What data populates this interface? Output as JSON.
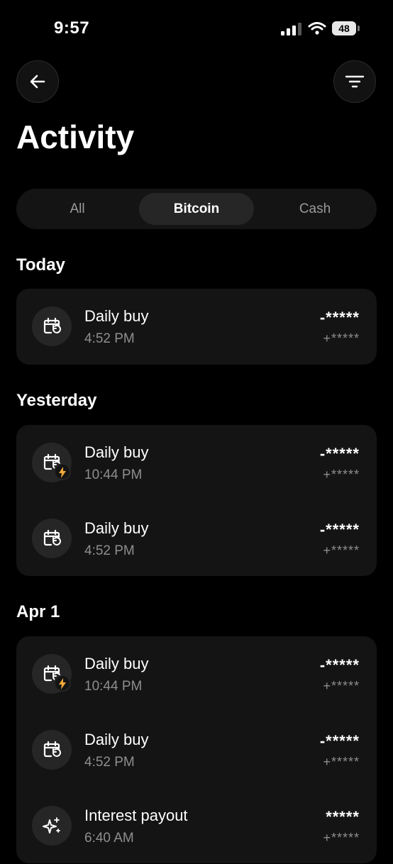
{
  "status_bar": {
    "time": "9:57",
    "battery": "48"
  },
  "page": {
    "title": "Activity"
  },
  "tabs": [
    {
      "label": "All"
    },
    {
      "label": "Bitcoin"
    },
    {
      "label": "Cash"
    }
  ],
  "active_tab": "Bitcoin",
  "sections": [
    {
      "title": "Today",
      "items": [
        {
          "title": "Daily buy",
          "time": "4:52 PM",
          "amount": "-*****",
          "sub_amount": "+*****",
          "icon": "calendar-repeat-icon",
          "lightning": false
        }
      ]
    },
    {
      "title": "Yesterday",
      "items": [
        {
          "title": "Daily buy",
          "time": "10:44 PM",
          "amount": "-*****",
          "sub_amount": "+*****",
          "icon": "calendar-repeat-icon",
          "lightning": true
        },
        {
          "title": "Daily buy",
          "time": "4:52 PM",
          "amount": "-*****",
          "sub_amount": "+*****",
          "icon": "calendar-repeat-icon",
          "lightning": false
        }
      ]
    },
    {
      "title": "Apr 1",
      "items": [
        {
          "title": "Daily buy",
          "time": "10:44 PM",
          "amount": "-*****",
          "sub_amount": "+*****",
          "icon": "calendar-repeat-icon",
          "lightning": true
        },
        {
          "title": "Daily buy",
          "time": "4:52 PM",
          "amount": "-*****",
          "sub_amount": "+*****",
          "icon": "calendar-repeat-icon",
          "lightning": false
        },
        {
          "title": "Interest payout",
          "time": "6:40 AM",
          "amount": "*****",
          "sub_amount": "+*****",
          "icon": "sparkle-icon",
          "lightning": false
        }
      ]
    }
  ],
  "colors": {
    "background": "#000000",
    "card": "#141414",
    "muted_text": "#8e8e8e",
    "lightning": "#f2a93b"
  }
}
